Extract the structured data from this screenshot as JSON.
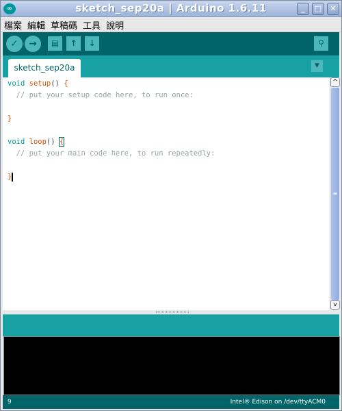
{
  "window": {
    "title": "sketch_sep20a | Arduino 1.6.11",
    "minimize": "_",
    "maximize": "□",
    "close": "✕",
    "logo": "∞"
  },
  "menu": [
    "檔案",
    "編輯",
    "草稿碼",
    "工具",
    "說明"
  ],
  "toolbar": {
    "verify": "✓",
    "upload": "→",
    "new": "▤",
    "open": "↑",
    "save": "↓",
    "serial_monitor": "⚲"
  },
  "tabs": [
    {
      "label": "sketch_sep20a"
    }
  ],
  "tab_menu": "▼",
  "code": {
    "l1_kw": "void",
    "l1_fn": "setup",
    "l1_rest": "() ",
    "l1_brace": "{",
    "l2": "  // put your setup code here, to run once:",
    "l4": "}",
    "l6_kw": "void",
    "l6_fn": "loop",
    "l6_rest": "() ",
    "l6_brace": "{",
    "l7": "  // put your main code here, to run repeatedly:",
    "l9": "}"
  },
  "scroll": {
    "up": "^",
    "down": "v",
    "grip": "≡"
  },
  "status": {
    "line": "9",
    "board": "Intel® Edison on /dev/ttyACM0"
  },
  "colors": {
    "toolbar": "#006468",
    "tabbar": "#17A1A5",
    "keyword": "#00979C",
    "function": "#D35400",
    "comment": "#95A5A6"
  }
}
